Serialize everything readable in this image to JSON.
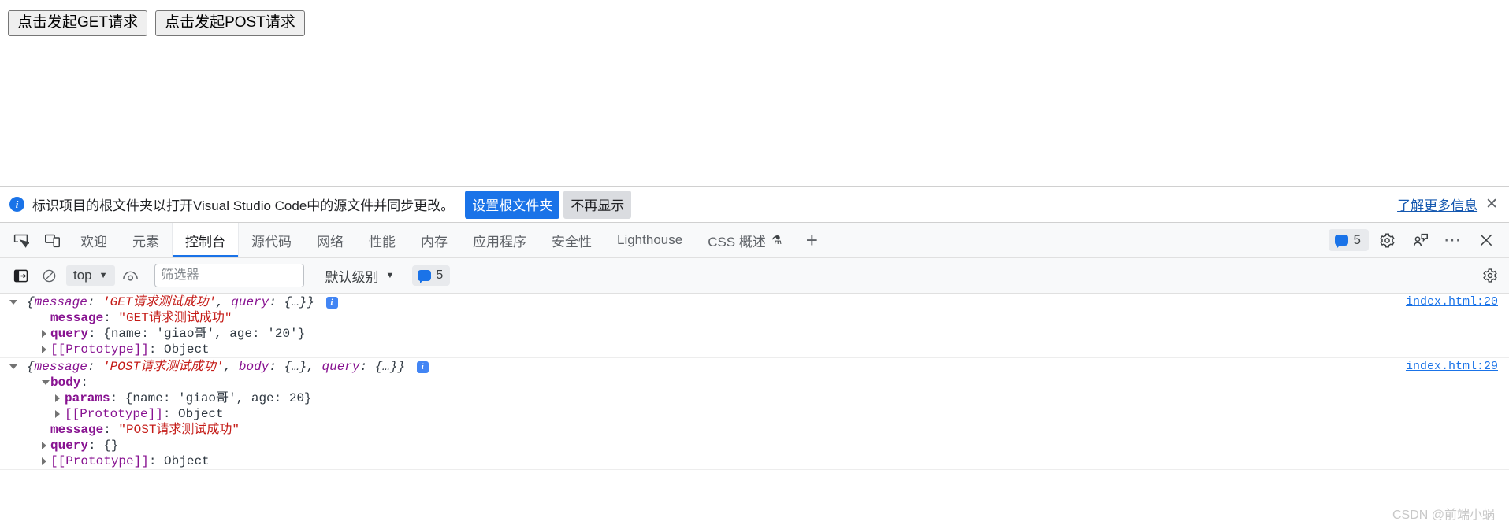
{
  "page": {
    "buttons": [
      {
        "label": "点击发起GET请求",
        "name": "get-request-button"
      },
      {
        "label": "点击发起POST请求",
        "name": "post-request-button"
      }
    ]
  },
  "infobar": {
    "icon": "info-circle-icon",
    "message": "标识项目的根文件夹以打开Visual Studio Code中的源文件并同步更改。",
    "primary_button": "设置根文件夹",
    "secondary_button": "不再显示",
    "link": "了解更多信息",
    "close": "✕"
  },
  "devtools": {
    "left_icons": [
      {
        "name": "inspect-element-icon"
      },
      {
        "name": "device-toolbar-icon"
      }
    ],
    "tabs": [
      {
        "label": "欢迎",
        "active": false
      },
      {
        "label": "元素",
        "active": false
      },
      {
        "label": "控制台",
        "active": true
      },
      {
        "label": "源代码",
        "active": false
      },
      {
        "label": "网络",
        "active": false
      },
      {
        "label": "性能",
        "active": false
      },
      {
        "label": "内存",
        "active": false
      },
      {
        "label": "应用程序",
        "active": false
      },
      {
        "label": "安全性",
        "active": false
      },
      {
        "label": "Lighthouse",
        "active": false
      },
      {
        "label": "CSS 概述",
        "active": false,
        "flask": "⚗"
      }
    ],
    "add_tab": "+",
    "right": {
      "message_count": "5",
      "settings_icon": "gear-icon",
      "feedback_icon": "feedback-person-icon",
      "more_icon": "more-options-icon",
      "close_icon": "close-icon"
    }
  },
  "console_toolbar": {
    "sidebar_toggle": "console-sidebar-icon",
    "clear_button": "clear-console-icon",
    "context": "top",
    "eye_icon": "live-expression-icon",
    "filter_placeholder": "筛选器",
    "filter_value": "",
    "level": "默认级别",
    "issues_count": "5",
    "settings_icon": "console-settings-icon"
  },
  "console": {
    "groups": [
      {
        "source": "index.html:20",
        "header": {
          "prefix": "{",
          "k1": "message",
          "sep1": ": ",
          "v1": "'GET请求测试成功'",
          "comma": ", ",
          "k2": "query",
          "sep2": ": ",
          "v2": "{…}",
          "suffix": "}",
          "info_badge": "i"
        },
        "rows": [
          {
            "indent": 1,
            "arrow": "none",
            "key": "message",
            "sep": ": ",
            "value": "\"GET请求测试成功\"",
            "vtype": "str"
          },
          {
            "indent": 1,
            "arrow": "closed",
            "key": "query",
            "sep": ": ",
            "value": "{name: 'giao哥', age: '20'}",
            "vtype": "obj"
          },
          {
            "indent": 1,
            "arrow": "closed",
            "key": "[[Prototype]]",
            "sep": ": ",
            "value": "Object",
            "vtype": "plain"
          }
        ]
      },
      {
        "source": "index.html:29",
        "header": {
          "prefix": "{",
          "k1": "message",
          "sep1": ": ",
          "v1": "'POST请求测试成功'",
          "comma": ", ",
          "k2": "body",
          "sep2": ": ",
          "v2": "{…}",
          "comma2": ", ",
          "k3": "query",
          "sep3": ": ",
          "v3": "{…}",
          "suffix": "}",
          "info_badge": "i"
        },
        "rows": [
          {
            "indent": 1,
            "arrow": "open",
            "key": "body",
            "sep": ":",
            "value": "",
            "vtype": "plain"
          },
          {
            "indent": 2,
            "arrow": "closed",
            "key": "params",
            "sep": ": ",
            "value": "{name: 'giao哥', age: 20}",
            "vtype": "obj"
          },
          {
            "indent": 2,
            "arrow": "closed",
            "key": "[[Prototype]]",
            "sep": ": ",
            "value": "Object",
            "vtype": "plain"
          },
          {
            "indent": 1,
            "arrow": "none",
            "key": "message",
            "sep": ": ",
            "value": "\"POST请求测试成功\"",
            "vtype": "str"
          },
          {
            "indent": 1,
            "arrow": "closed",
            "key": "query",
            "sep": ": ",
            "value": "{}",
            "vtype": "obj"
          },
          {
            "indent": 1,
            "arrow": "closed",
            "key": "[[Prototype]]",
            "sep": ": ",
            "value": "Object",
            "vtype": "plain"
          }
        ]
      }
    ]
  },
  "watermark": "CSDN @前端小蜗",
  "colors": {
    "accent": "#1a73e8",
    "string": "#c41a16",
    "key": "#881391",
    "number": "#1c00cf",
    "link": "#1a73e8"
  }
}
